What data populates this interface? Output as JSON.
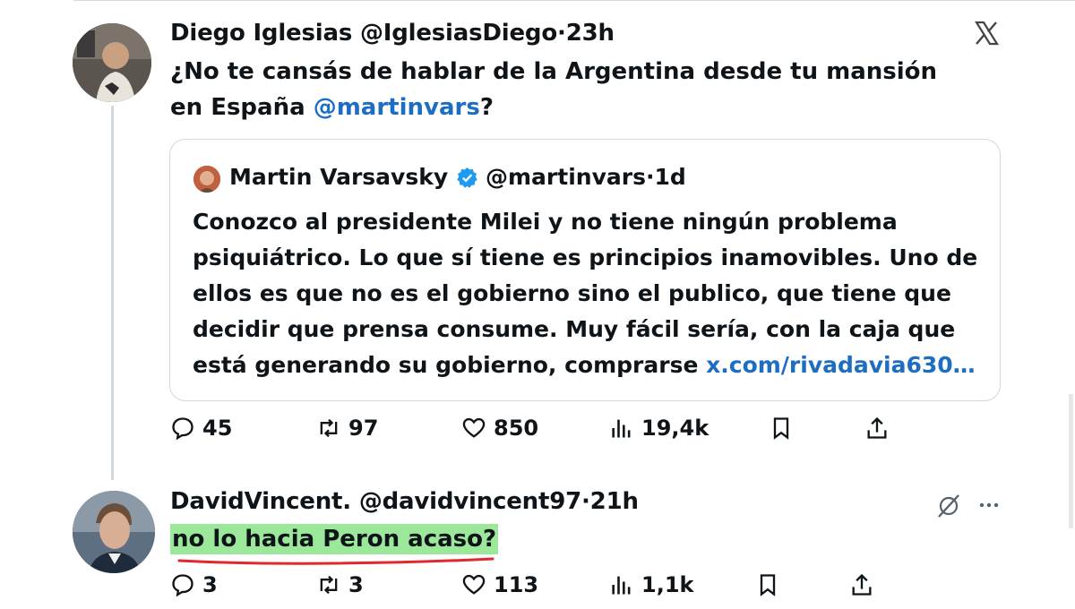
{
  "tweet": {
    "author_name": "Diego Iglesias",
    "author_handle": "@IglesiasDiego",
    "separator": "·",
    "time": "23h",
    "text_before": "¿No te cansás de hablar de la Argentina desde tu mansión en España ",
    "mention": "@martinvars",
    "text_after": "?",
    "quote": {
      "author_name": "Martin Varsavsky",
      "author_handle": "@martinvars",
      "separator": "·",
      "time": "1d",
      "text": "Conozco al presidente Milei y  no tiene ningún problema psiquiátrico. Lo que sí tiene es principios inamovibles. Uno de ellos es que no es el gobierno sino el publico, que tiene que decidir que prensa consume. Muy fácil sería, con la caja que está generando su gobierno, comprarse ",
      "link": "x.com/rivadavia630…"
    },
    "stats": {
      "replies": "45",
      "reposts": "97",
      "likes": "850",
      "views": "19,4k"
    }
  },
  "reply": {
    "author_name": "DavidVincent.",
    "author_handle": "@davidvincent97",
    "separator": "·",
    "time": "21h",
    "text": "no lo hacia Peron acaso?",
    "stats": {
      "replies": "3",
      "reposts": "3",
      "likes": "113",
      "views": "1,1k"
    }
  },
  "colors": {
    "link": "#1d6ec2",
    "highlight": "#9be89b",
    "underline": "#e0282e",
    "verified": "#1d9bf0"
  }
}
